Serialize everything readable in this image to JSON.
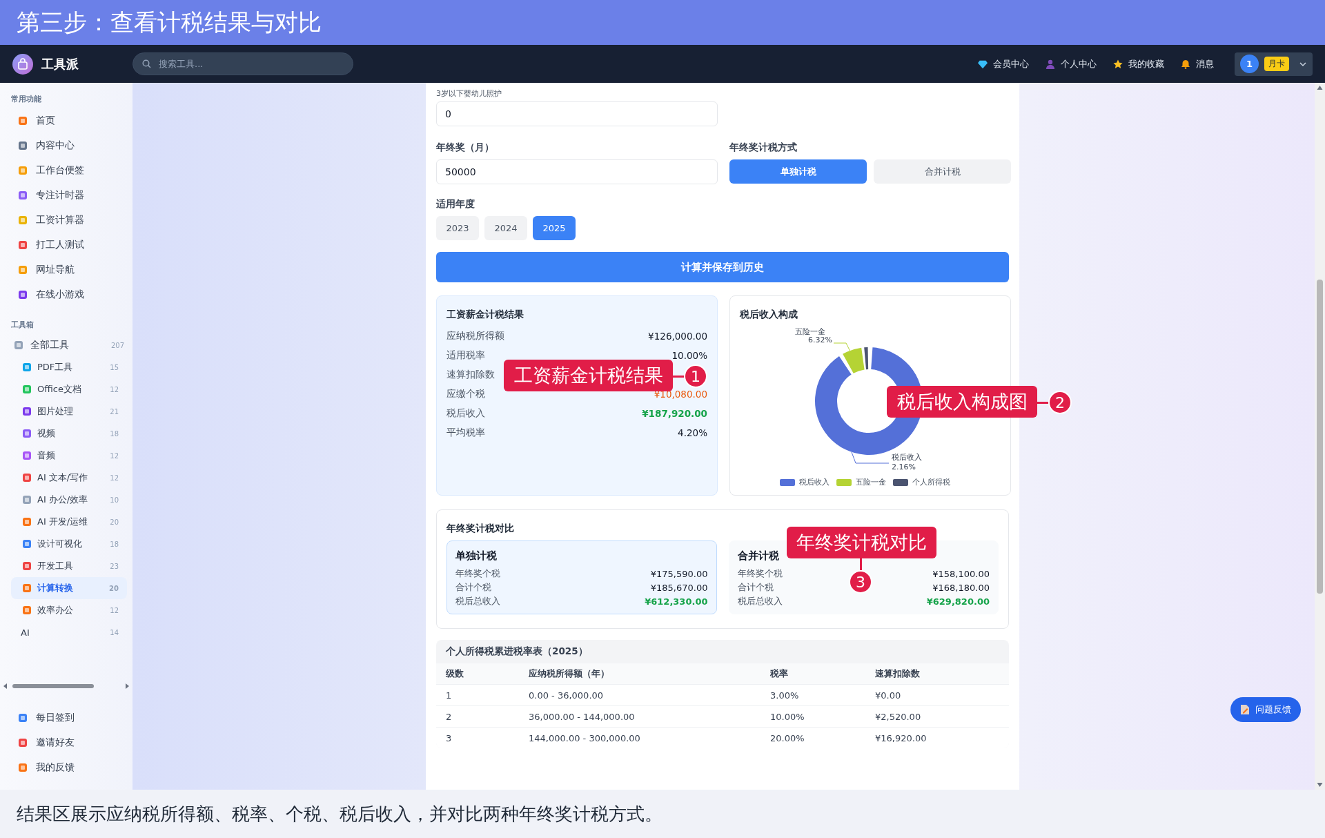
{
  "banner": {
    "title": "第三步：查看计税结果与对比"
  },
  "header": {
    "logo": "工具派",
    "search": {
      "placeholder": "搜索工具..."
    },
    "nav": [
      {
        "label": "会员中心"
      },
      {
        "label": "个人中心"
      },
      {
        "label": "我的收藏"
      },
      {
        "label": "消息"
      }
    ],
    "user": {
      "avatar": "1",
      "badge": "月卡"
    }
  },
  "sidebar": {
    "sections": [
      {
        "title": "常用功能",
        "items": [
          {
            "label": "首页",
            "selected": false
          },
          {
            "label": "内容中心",
            "selected": false
          },
          {
            "label": "工作台便签",
            "selected": false
          },
          {
            "label": "专注计时器",
            "selected": false
          },
          {
            "label": "工资计算器",
            "selected": false
          },
          {
            "label": "打工人测试",
            "selected": false
          },
          {
            "label": "网址导航",
            "selected": false
          },
          {
            "label": "在线小游戏",
            "selected": false
          }
        ]
      },
      {
        "title": "工具箱",
        "items": [
          {
            "label": "全部工具",
            "count": "207",
            "selected": false,
            "children": [
              {
                "label": "PDF工具",
                "count": "15",
                "kind": "tool",
                "selected": false
              },
              {
                "label": "Office文档",
                "count": "12",
                "kind": "tool",
                "selected": false
              },
              {
                "label": "图片处理",
                "count": "21",
                "kind": "tool",
                "selected": false
              },
              {
                "label": "视频",
                "count": "18",
                "kind": "tool",
                "selected": false
              },
              {
                "label": "音频",
                "count": "12",
                "kind": "tool",
                "selected": false
              },
              {
                "label": "AI 文本/写作",
                "count": "12",
                "kind": "tool",
                "selected": false
              },
              {
                "label": "AI 办公/效率",
                "count": "10",
                "kind": "tool",
                "selected": false
              },
              {
                "label": "AI 开发/运维",
                "count": "20",
                "kind": "tool",
                "selected": false
              },
              {
                "label": "设计可视化",
                "count": "18",
                "kind": "tool",
                "selected": false
              },
              {
                "label": "开发工具",
                "count": "23",
                "kind": "tool",
                "selected": false
              },
              {
                "label": "计算转换",
                "count": "20",
                "kind": "tool",
                "selected": true
              },
              {
                "label": "效率办公",
                "count": "12",
                "kind": "tool",
                "selected": false
              },
              {
                "label": "AI",
                "count": "14",
                "kind": "text",
                "selected": false
              }
            ]
          }
        ]
      }
    ],
    "bottom_items": [
      {
        "label": "每日签到",
        "selected": false
      },
      {
        "label": "邀请好友",
        "selected": false
      },
      {
        "label": "我的反馈",
        "selected": false
      }
    ]
  },
  "form": {
    "childcare": {
      "label": "3岁以下婴幼儿照护",
      "value": "0"
    },
    "bonus": {
      "label": "年终奖（月）",
      "value": "50000"
    },
    "method": {
      "label": "年终奖计税方式",
      "options": [
        {
          "label": "单独计税",
          "selected": true
        },
        {
          "label": "合并计税",
          "selected": false
        }
      ]
    },
    "year": {
      "label": "适用年度",
      "options": [
        {
          "label": "2023",
          "selected": false
        },
        {
          "label": "2024",
          "selected": false
        },
        {
          "label": "2025",
          "selected": true
        }
      ]
    },
    "submit": "计算并保存到历史"
  },
  "result": {
    "title": "工资薪金计税结果",
    "rows": [
      {
        "label": "应纳税所得额",
        "value": "¥126,000.00",
        "kind": "plain"
      },
      {
        "label": "适用税率",
        "value": "10.00%",
        "kind": "plain"
      },
      {
        "label": "速算扣除数",
        "kind": "plain"
      },
      {
        "label": "应缴个税",
        "value": "¥10,080.00",
        "kind": "tax"
      },
      {
        "label": "税后收入",
        "value": "¥187,920.00",
        "kind": "income"
      },
      {
        "label": "平均税率",
        "value": "4.20%",
        "kind": "plain"
      }
    ]
  },
  "composition": {
    "title": "税后收入构成",
    "top_label": {
      "name": "五险一金",
      "percent": "6.32%"
    },
    "bottom_label": {
      "name": "税后收入",
      "percent": "2.16%"
    },
    "legend": [
      {
        "label": "税后收入",
        "color": "#5470d8"
      },
      {
        "label": "五险一金",
        "color": "#b5d334"
      },
      {
        "label": "个人所得税",
        "color": "#4b5470"
      }
    ]
  },
  "comparison": {
    "title": "年终奖计税对比",
    "options": [
      {
        "title": "单独计税",
        "selected": true,
        "rows": [
          {
            "label": "年终奖个税",
            "value": "¥175,590.00",
            "kind": "plain"
          },
          {
            "label": "合计个税",
            "value": "¥185,670.00",
            "kind": "plain"
          },
          {
            "label": "税后总收入",
            "value": "¥612,330.00",
            "kind": "income"
          }
        ]
      },
      {
        "title": "合并计税",
        "selected": false,
        "rows": [
          {
            "label": "年终奖个税",
            "value": "¥158,100.00",
            "kind": "plain"
          },
          {
            "label": "合计个税",
            "value": "¥168,180.00",
            "kind": "plain"
          },
          {
            "label": "税后总收入",
            "value": "¥629,820.00",
            "kind": "income"
          }
        ]
      }
    ]
  },
  "table": {
    "title": "个人所得税累进税率表（2025）",
    "columns": [
      "级数",
      "应纳税所得额（年）",
      "税率",
      "速算扣除数"
    ],
    "rows": [
      [
        "1",
        "0.00 - 36,000.00",
        "3.00%",
        "¥0.00"
      ],
      [
        "2",
        "36,000.00 - 144,000.00",
        "10.00%",
        "¥2,520.00"
      ],
      [
        "3",
        "144,000.00 - 300,000.00",
        "20.00%",
        "¥16,920.00"
      ]
    ]
  },
  "callouts": [
    {
      "text": "工资薪金计税结果",
      "number": "1"
    },
    {
      "text": "税后收入构成图",
      "number": "2"
    },
    {
      "text": "年终奖计税对比",
      "number": "3"
    }
  ],
  "feedback": "问题反馈",
  "caption": "结果区展示应纳税所得额、税率、个税、税后收入，并对比两种年终奖计税方式。"
}
